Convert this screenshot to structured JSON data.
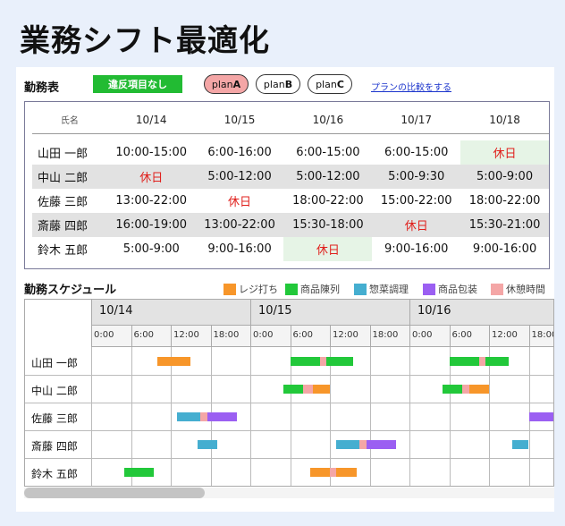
{
  "title": "業務シフト最適化",
  "roster": {
    "title": "勤務表",
    "status_badge": "違反項目なし",
    "plans": [
      {
        "prefix": "plan",
        "suffix": "A",
        "active": true
      },
      {
        "prefix": "plan",
        "suffix": "B",
        "active": false
      },
      {
        "prefix": "plan",
        "suffix": "C",
        "active": false
      }
    ],
    "compare_link": "プランの比較をする",
    "name_header": "氏名",
    "days": [
      "10/14",
      "10/15",
      "10/16",
      "10/17",
      "10/18"
    ],
    "rows": [
      {
        "name": "山田 一郎",
        "cells": [
          "10:00-15:00",
          "6:00-16:00",
          "6:00-15:00",
          "6:00-15:00",
          "休日"
        ],
        "hl": [
          false,
          false,
          false,
          false,
          true
        ]
      },
      {
        "name": "中山 二郎",
        "cells": [
          "休日",
          "5:00-12:00",
          "5:00-12:00",
          "5:00-9:30",
          "5:00-9:00"
        ],
        "hl": [
          false,
          false,
          false,
          false,
          false
        ]
      },
      {
        "name": "佐藤 三郎",
        "cells": [
          "13:00-22:00",
          "休日",
          "18:00-22:00",
          "15:00-22:00",
          "18:00-22:00"
        ],
        "hl": [
          false,
          false,
          false,
          false,
          false
        ]
      },
      {
        "name": "斎藤 四郎",
        "cells": [
          "16:00-19:00",
          "13:00-22:00",
          "15:30-18:00",
          "休日",
          "15:30-21:00"
        ],
        "hl": [
          false,
          false,
          false,
          false,
          false
        ]
      },
      {
        "name": "鈴木 五郎",
        "cells": [
          "5:00-9:00",
          "9:00-16:00",
          "休日",
          "9:00-16:00",
          "9:00-16:00"
        ],
        "hl": [
          false,
          false,
          true,
          false,
          false
        ]
      }
    ],
    "off_label": "休日"
  },
  "schedule": {
    "title": "勤務スケジュール",
    "legend": [
      {
        "label": "レジ打ち",
        "color": "#f7962a"
      },
      {
        "label": "商品陳列",
        "color": "#22c83a"
      },
      {
        "label": "惣菜調理",
        "color": "#45aed0"
      },
      {
        "label": "商品包装",
        "color": "#9b5ff2"
      },
      {
        "label": "休憩時間",
        "color": "#f4a6a6"
      }
    ],
    "dates": [
      "10/14",
      "10/15",
      "10/16"
    ],
    "hours": [
      "0:00",
      "6:00",
      "12:00",
      "18:00"
    ],
    "names": [
      "山田 一郎",
      "中山 二郎",
      "佐藤 三郎",
      "斎藤 四郎",
      "鈴木 五郎"
    ],
    "bars": [
      {
        "row": 0,
        "start": 10,
        "end": 15,
        "type": 0
      },
      {
        "row": 0,
        "start": 30,
        "end": 34.5,
        "type": 1
      },
      {
        "row": 0,
        "start": 34.5,
        "end": 35.5,
        "type": 4
      },
      {
        "row": 0,
        "start": 35.5,
        "end": 39.5,
        "type": 1
      },
      {
        "row": 0,
        "start": 54,
        "end": 58.5,
        "type": 1
      },
      {
        "row": 0,
        "start": 58.5,
        "end": 59.5,
        "type": 4
      },
      {
        "row": 0,
        "start": 59.5,
        "end": 63,
        "type": 1
      },
      {
        "row": 1,
        "start": 29,
        "end": 32,
        "type": 1
      },
      {
        "row": 1,
        "start": 32,
        "end": 33.5,
        "type": 4
      },
      {
        "row": 1,
        "start": 33.5,
        "end": 36,
        "type": 0
      },
      {
        "row": 1,
        "start": 53,
        "end": 56,
        "type": 1
      },
      {
        "row": 1,
        "start": 56,
        "end": 57,
        "type": 4
      },
      {
        "row": 1,
        "start": 57,
        "end": 60,
        "type": 0
      },
      {
        "row": 2,
        "start": 13,
        "end": 16.5,
        "type": 2
      },
      {
        "row": 2,
        "start": 16.5,
        "end": 17.5,
        "type": 4
      },
      {
        "row": 2,
        "start": 17.5,
        "end": 22,
        "type": 3
      },
      {
        "row": 2,
        "start": 66,
        "end": 70,
        "type": 3
      },
      {
        "row": 3,
        "start": 16,
        "end": 19,
        "type": 2
      },
      {
        "row": 3,
        "start": 37,
        "end": 40.5,
        "type": 2
      },
      {
        "row": 3,
        "start": 40.5,
        "end": 41.5,
        "type": 4
      },
      {
        "row": 3,
        "start": 41.5,
        "end": 46,
        "type": 3
      },
      {
        "row": 3,
        "start": 63.5,
        "end": 66,
        "type": 2
      },
      {
        "row": 4,
        "start": 5,
        "end": 9.5,
        "type": 1
      },
      {
        "row": 4,
        "start": 33,
        "end": 36,
        "type": 0
      },
      {
        "row": 4,
        "start": 36,
        "end": 37,
        "type": 4
      },
      {
        "row": 4,
        "start": 37,
        "end": 40,
        "type": 0
      }
    ]
  }
}
